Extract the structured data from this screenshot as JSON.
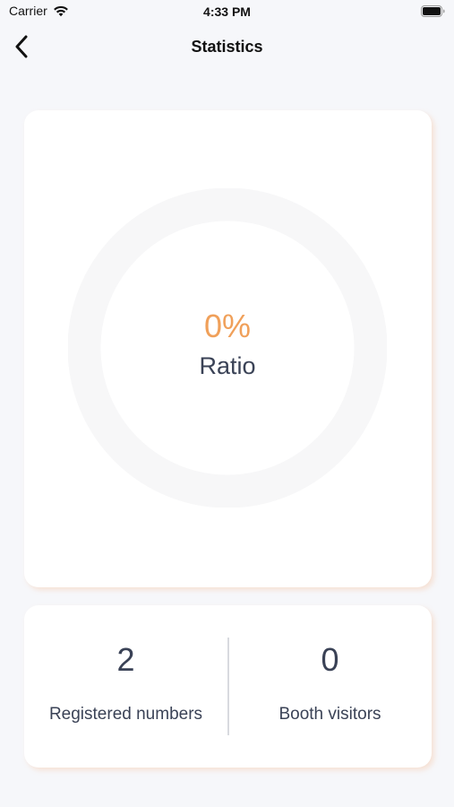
{
  "status_bar": {
    "carrier": "Carrier",
    "time": "4:33 PM",
    "icons": [
      "wifi-icon",
      "battery-icon"
    ]
  },
  "nav": {
    "title": "Statistics",
    "back_icon": "chevron-left-icon"
  },
  "ratio_card": {
    "value": "0%",
    "ratio": 0,
    "label": "Ratio",
    "colors": {
      "value": "#F0A05A",
      "track": "#F7F7F8",
      "progress": "#F0A05A"
    }
  },
  "counts": {
    "registered": {
      "value": "2",
      "label": "Registered numbers"
    },
    "booth": {
      "value": "0",
      "label": "Booth visitors"
    }
  },
  "colors": {
    "background": "#F6F7FA",
    "card": "#FFFFFF",
    "text": "#3A4256",
    "accent": "#F0A05A"
  }
}
